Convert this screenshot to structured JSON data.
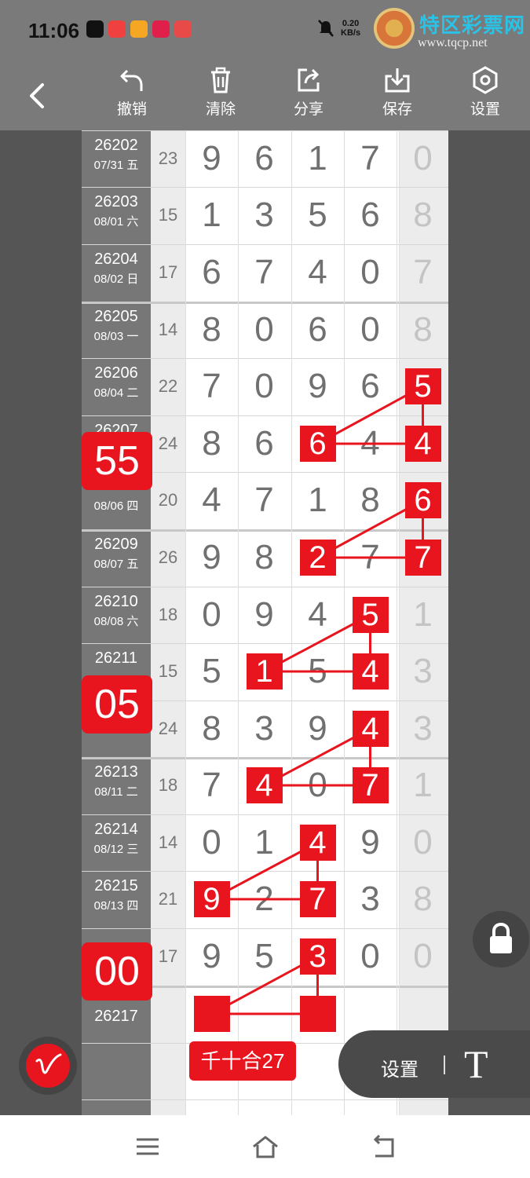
{
  "status": {
    "time": "11:06",
    "net_speed": "0.20",
    "net_unit": "KB/s",
    "app_icon_colors": [
      "#111111",
      "#f04040",
      "#f5a623",
      "#e0204a",
      "#e84a4a"
    ]
  },
  "watermark": {
    "title": "特区彩票网",
    "url": "www.tqcp.net"
  },
  "toolbar": {
    "back_icon": "chevron-left-icon",
    "undo_label": "撤销",
    "clear_label": "清除",
    "share_label": "分享",
    "save_label": "保存",
    "settings_label": "设置"
  },
  "rows": [
    {
      "issue": "26202",
      "date": "07/31 五",
      "sum": "23",
      "digits": [
        "9",
        "6",
        "1",
        "7",
        "0"
      ]
    },
    {
      "issue": "26203",
      "date": "08/01 六",
      "sum": "15",
      "digits": [
        "1",
        "3",
        "5",
        "6",
        "8"
      ]
    },
    {
      "issue": "26204",
      "date": "08/02 日",
      "sum": "17",
      "digits": [
        "6",
        "7",
        "4",
        "0",
        "7"
      ]
    },
    {
      "issue": "26205",
      "date": "08/03 一",
      "sum": "14",
      "digits": [
        "8",
        "0",
        "6",
        "0",
        "8"
      ]
    },
    {
      "issue": "26206",
      "date": "08/04 二",
      "sum": "22",
      "digits": [
        "7",
        "0",
        "9",
        "6",
        "5"
      ]
    },
    {
      "issue": "26207",
      "date": "",
      "sum": "24",
      "digits": [
        "8",
        "6",
        "6",
        "4",
        "4"
      ]
    },
    {
      "issue": "",
      "date": "08/06 四",
      "sum": "20",
      "digits": [
        "4",
        "7",
        "1",
        "8",
        "6"
      ]
    },
    {
      "issue": "26209",
      "date": "08/07 五",
      "sum": "26",
      "digits": [
        "9",
        "8",
        "2",
        "7",
        "7"
      ]
    },
    {
      "issue": "26210",
      "date": "08/08 六",
      "sum": "18",
      "digits": [
        "0",
        "9",
        "4",
        "5",
        "1"
      ]
    },
    {
      "issue": "26211",
      "date": "",
      "sum": "15",
      "digits": [
        "5",
        "1",
        "5",
        "4",
        "3"
      ]
    },
    {
      "issue": "",
      "date": "",
      "sum": "24",
      "digits": [
        "8",
        "3",
        "9",
        "4",
        "3"
      ]
    },
    {
      "issue": "26213",
      "date": "08/11 二",
      "sum": "18",
      "digits": [
        "7",
        "4",
        "0",
        "7",
        "1"
      ]
    },
    {
      "issue": "26214",
      "date": "08/12 三",
      "sum": "14",
      "digits": [
        "0",
        "1",
        "4",
        "9",
        "0"
      ]
    },
    {
      "issue": "26215",
      "date": "08/13 四",
      "sum": "21",
      "digits": [
        "9",
        "2",
        "7",
        "3",
        "8"
      ]
    },
    {
      "issue": "",
      "date": "",
      "sum": "17",
      "digits": [
        "9",
        "5",
        "3",
        "0",
        "0"
      ]
    },
    {
      "issue": "26217",
      "date": "",
      "sum": "",
      "digits": [
        "",
        "",
        "",
        "",
        ""
      ]
    }
  ],
  "tags": [
    "55",
    "05",
    "00"
  ],
  "sum_tag": "千十合27",
  "floating": {
    "pen_icon": "pen-icon",
    "lock_icon": "lock-icon",
    "settings_label": "设置",
    "text_tool_label": "T"
  },
  "colors": {
    "highlight": "#e8141e",
    "toolbar": "#7a7a7a"
  }
}
